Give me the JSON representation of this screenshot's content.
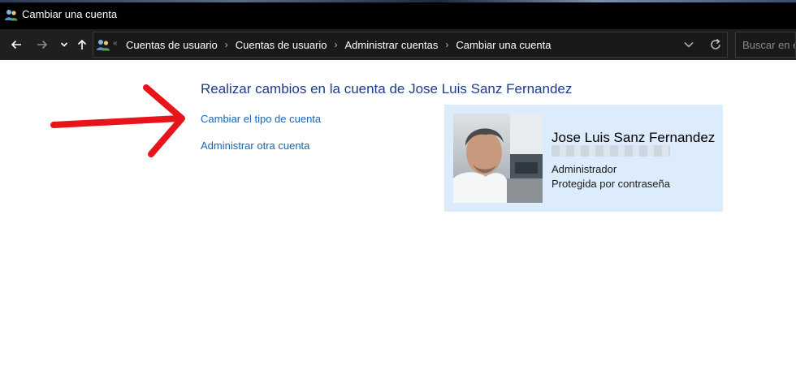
{
  "window": {
    "title": "Cambiar una cuenta",
    "icon": "users-icon"
  },
  "nav": {
    "back_icon": "back-arrow-icon",
    "forward_icon": "forward-arrow-icon",
    "recent_icon": "chevron-down-icon",
    "up_icon": "up-arrow-icon",
    "address": {
      "icon": "users-icon",
      "overflow": "«",
      "breadcrumbs": [
        "Cuentas de usuario",
        "Cuentas de usuario",
        "Administrar cuentas",
        "Cambiar una cuenta"
      ],
      "separator": "›"
    },
    "search_placeholder": "Buscar en e"
  },
  "main": {
    "heading": "Realizar cambios en la cuenta de Jose Luis Sanz Fernandez",
    "links": [
      "Cambiar el tipo de cuenta",
      "Administrar otra cuenta"
    ]
  },
  "account": {
    "name": "Jose Luis Sanz Fernandez",
    "role": "Administrador",
    "status": "Protegida por contraseña"
  },
  "colors": {
    "heading": "#1e3b8a",
    "link": "#1a64b4",
    "card_bg": "#dcecfc",
    "annotation_arrow": "#e8141b"
  }
}
